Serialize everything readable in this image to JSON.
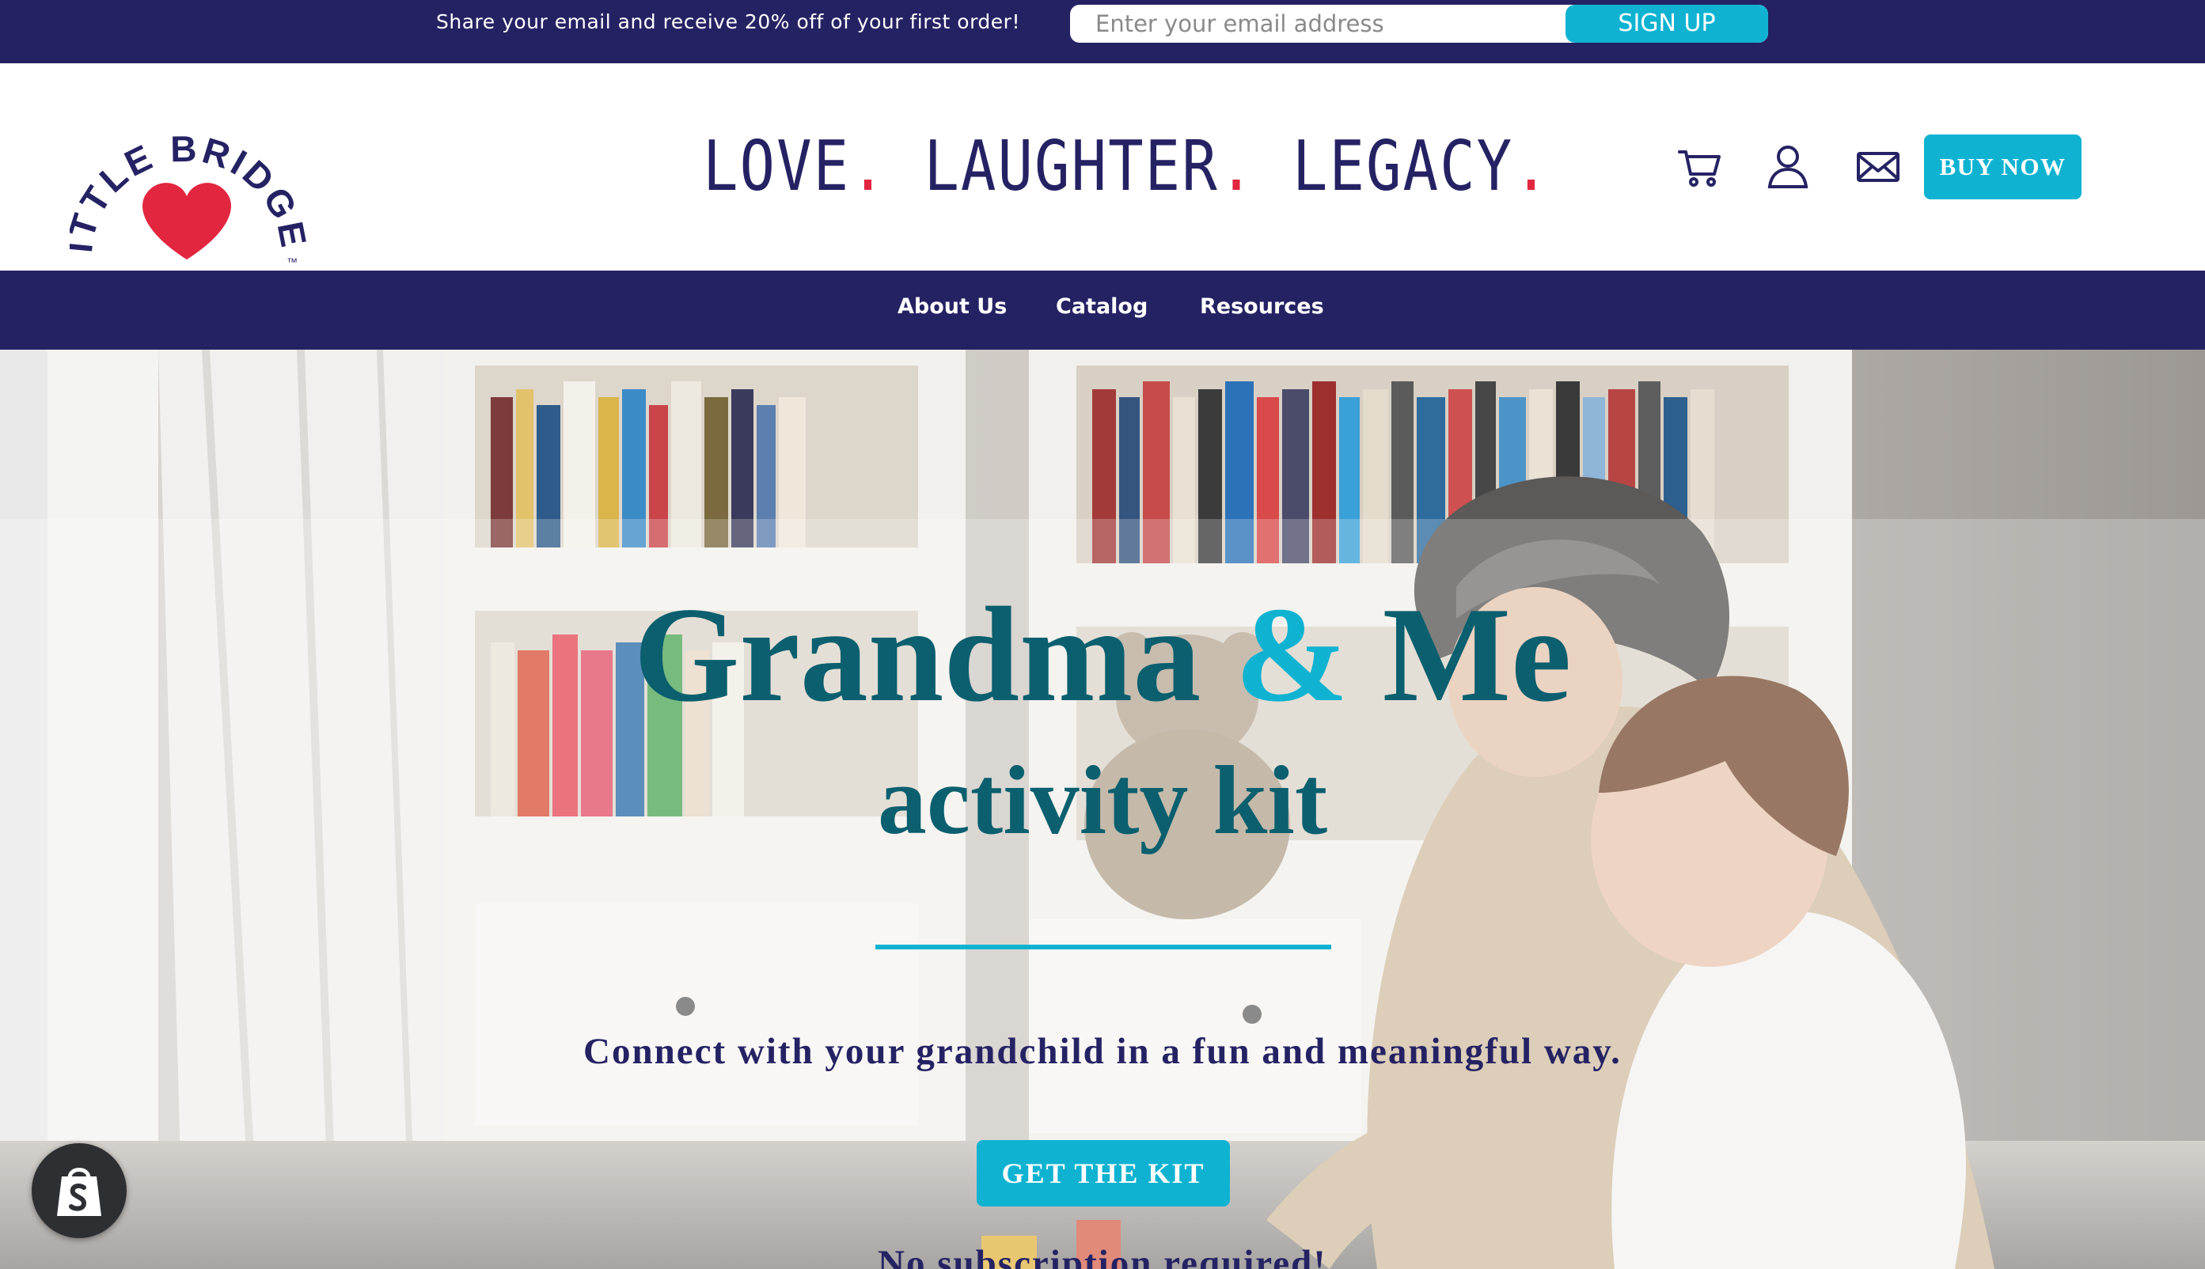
{
  "colors": {
    "navy": "#252264",
    "cyan": "#0fb3d1",
    "teal": "#0b5f6e",
    "heart_red": "#e2263f"
  },
  "promo": {
    "text": "Share your email and receive 20% off of your first order!",
    "email_placeholder": "Enter your email address",
    "signup_label": "SIGN UP"
  },
  "header": {
    "logo_text": "LITTLE BRIDGES",
    "logo_trademark": "™",
    "tagline": {
      "word1": "LOVE",
      "word2": "LAUGHTER",
      "word3": "LEGACY",
      "dot": "."
    },
    "icons": [
      "cart-icon",
      "user-icon",
      "mail-icon"
    ],
    "buy_now_label": "BUY NOW"
  },
  "nav": {
    "items": [
      {
        "label": "About Us"
      },
      {
        "label": "Catalog"
      },
      {
        "label": "Resources"
      }
    ]
  },
  "hero": {
    "title_part1": "Grandma",
    "title_amp": "&",
    "title_part2": "Me",
    "subtitle": "activity kit",
    "copy": "Connect with your grandchild in a fun and meaningful way.",
    "cta_label": "GET THE KIT",
    "note": "No subscription required!"
  },
  "shop_badge": {
    "icon": "shopify-bag-icon"
  }
}
